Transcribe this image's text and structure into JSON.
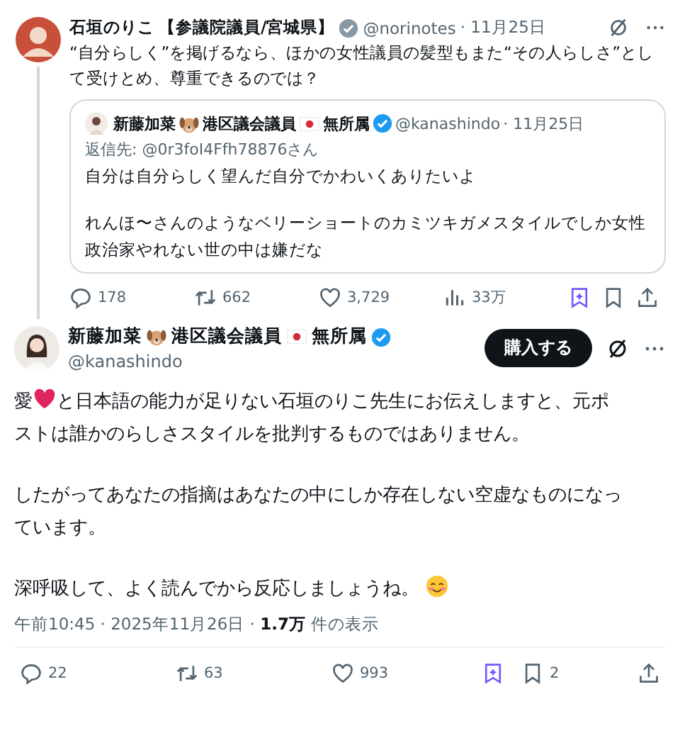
{
  "parent_post": {
    "author": {
      "name": [
        {
          "kind": "text",
          "text": "石垣のりこ"
        },
        {
          "kind": "text",
          "text": "【参議院議員/宮城県】"
        }
      ],
      "verified": true,
      "handle": "@norinotes",
      "date": "· 11月25日"
    },
    "text": "“自分らしく”を掲げるなら、ほかの女性議員の髪型もまた“その人らしさ”として受けとめ、尊重できるのでは？",
    "quote": {
      "author": {
        "name": [
          {
            "kind": "text",
            "text": "新藤加菜"
          },
          {
            "kind": "dog"
          },
          {
            "kind": "text",
            "text": "港区議会議員"
          },
          {
            "kind": "flag"
          },
          {
            "kind": "text",
            "text": "無所属"
          }
        ],
        "verified": true,
        "handle": "@kanashindo",
        "date": "· 11月25日"
      },
      "reply_to": "返信先: @0r3foI4Ffh78876さん",
      "paragraphs": [
        "自分は自分らしく望んだ自分でかわいくありたいよ",
        "れんほ〜さんのようなベリーショートのカミツキガメスタイルでしか女性政治家やれない世の中は嫌だな"
      ]
    },
    "actions": [
      {
        "kind": "reply",
        "count": "178"
      },
      {
        "kind": "repost",
        "count": "662"
      },
      {
        "kind": "like",
        "count": "3,729"
      },
      {
        "kind": "views",
        "count": "33万"
      },
      {
        "kind": "grok"
      },
      {
        "kind": "bookmark"
      },
      {
        "kind": "share"
      }
    ]
  },
  "main_post": {
    "author": {
      "name": [
        {
          "kind": "text",
          "text": "新藤加菜"
        },
        {
          "kind": "dog"
        },
        {
          "kind": "text",
          "text": "港区議会議員"
        },
        {
          "kind": "flag"
        },
        {
          "kind": "text",
          "text": "無所属"
        }
      ],
      "verified": true,
      "handle": "@kanashindo"
    },
    "buy_button": "購入する",
    "paragraphs": [
      [
        [
          {
            "kind": "text",
            "text": "愛"
          },
          {
            "kind": "heart"
          },
          {
            "kind": "text",
            "text": "と日本語の能力が足りない石垣のりこ先生にお伝えしますと、元ポ"
          }
        ],
        [
          {
            "kind": "text",
            "text": "ストは誰かのらしさスタイルを批判するものではありません。"
          }
        ]
      ],
      [
        [
          {
            "kind": "text",
            "text": "したがってあなたの指摘はあなたの中にしか存在しない空虚なものになっ"
          }
        ],
        [
          {
            "kind": "text",
            "text": "ています。"
          }
        ]
      ],
      [
        [
          {
            "kind": "text",
            "text": "深呼吸して、よく読んでから反応しましょうね。"
          },
          {
            "kind": "smile"
          }
        ]
      ]
    ],
    "timestamp": "午前10:45 · 2025年11月26日 · **1.7万** 件の表示",
    "actions": [
      {
        "kind": "reply",
        "count": "22"
      },
      {
        "kind": "repost",
        "count": "63"
      },
      {
        "kind": "like",
        "count": "993"
      },
      {
        "kind": "grok"
      },
      {
        "kind": "bookmark",
        "count": "2"
      },
      {
        "kind": "share"
      }
    ]
  }
}
